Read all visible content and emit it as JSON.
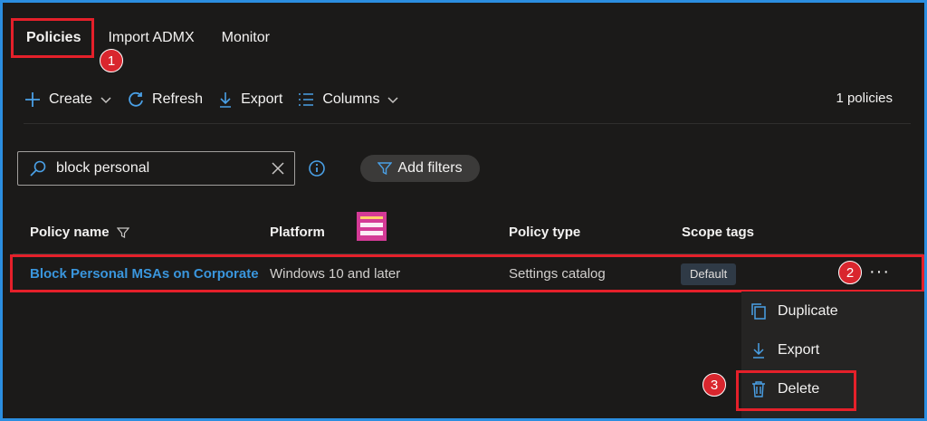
{
  "tabs": [
    {
      "label": "Policies",
      "active": true
    },
    {
      "label": "Import ADMX",
      "active": false
    },
    {
      "label": "Monitor",
      "active": false
    }
  ],
  "toolbar": {
    "create_label": "Create",
    "refresh_label": "Refresh",
    "export_label": "Export",
    "columns_label": "Columns",
    "count": "1 policies"
  },
  "search": {
    "value": "block personal"
  },
  "filters": {
    "add_label": "Add filters"
  },
  "table": {
    "headers": {
      "policy_name": "Policy name",
      "platform": "Platform",
      "policy_type": "Policy type",
      "scope_tags": "Scope tags"
    },
    "rows": [
      {
        "policy_name": "Block Personal MSAs on Corporate",
        "platform": "Windows 10 and later",
        "policy_type": "Settings catalog",
        "scope_tags": "Default"
      }
    ]
  },
  "row_menu": {
    "more_label": "···",
    "items": [
      {
        "label": "Duplicate",
        "icon": "duplicate-icon"
      },
      {
        "label": "Export",
        "icon": "download-icon"
      },
      {
        "label": "Delete",
        "icon": "trash-icon"
      }
    ]
  },
  "annotations": {
    "step1": "1",
    "step2": "2",
    "step3": "3"
  },
  "colors": {
    "accent": "#3a96dd",
    "highlight": "#e5202a",
    "background": "#1b1a19"
  }
}
